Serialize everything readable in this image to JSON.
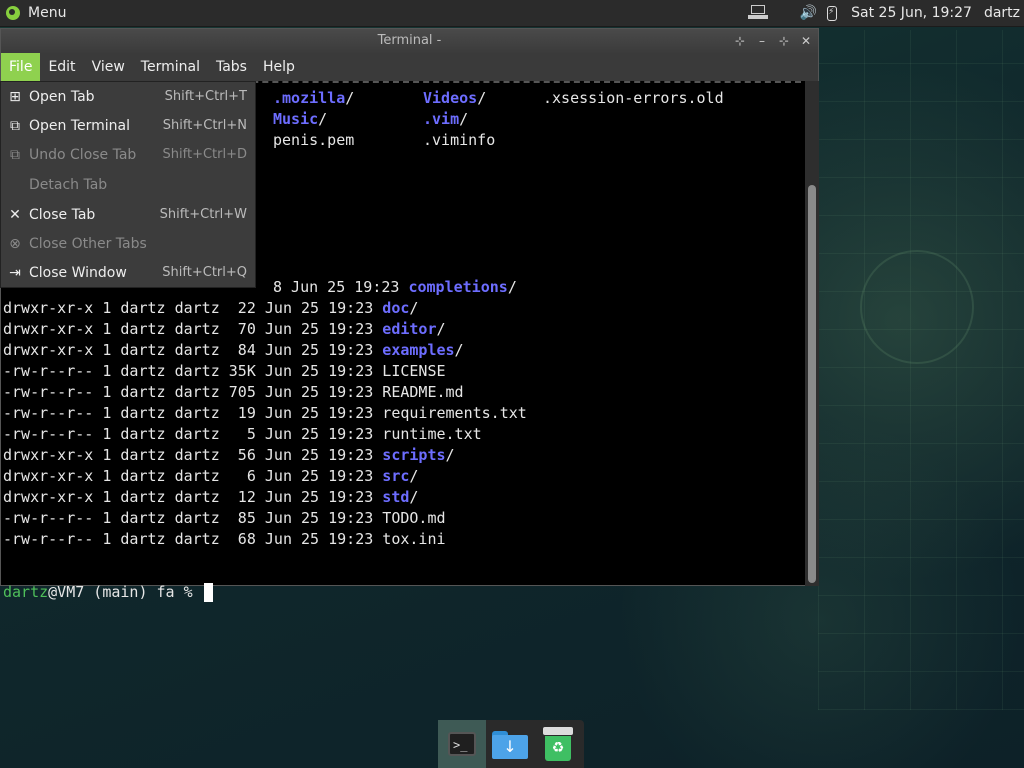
{
  "panel": {
    "menu_label": "Menu",
    "clock": "Sat 25 Jun, 19:27",
    "user": "dartz"
  },
  "window": {
    "title": "Terminal -",
    "menus": [
      "File",
      "Edit",
      "View",
      "Terminal",
      "Tabs",
      "Help"
    ],
    "active_menu": "File"
  },
  "file_menu": {
    "items": [
      {
        "label": "Open Tab",
        "shortcut": "Shift+Ctrl+T",
        "icon": "open-tab-icon",
        "enabled": true
      },
      {
        "label": "Open Terminal",
        "shortcut": "Shift+Ctrl+N",
        "icon": "open-terminal-icon",
        "enabled": true
      },
      {
        "label": "Undo Close Tab",
        "shortcut": "Shift+Ctrl+D",
        "icon": "undo-close-tab-icon",
        "enabled": false
      },
      {
        "label": "Detach Tab",
        "shortcut": "",
        "icon": "",
        "enabled": false
      },
      {
        "label": "Close Tab",
        "shortcut": "Shift+Ctrl+W",
        "icon": "close-icon",
        "enabled": true
      },
      {
        "label": "Close Other Tabs",
        "shortcut": "",
        "icon": "close-other-tabs-icon",
        "enabled": false
      },
      {
        "label": "Close Window",
        "shortcut": "Shift+Ctrl+Q",
        "icon": "close-window-icon",
        "enabled": true
      }
    ]
  },
  "terminal": {
    "top_listing": [
      {
        "col": ".mozilla",
        "suffix": "/",
        "dir": true
      },
      {
        "col": "Videos",
        "suffix": "/",
        "dir": true
      },
      {
        "col": ".xsession-errors.old",
        "suffix": "",
        "dir": false
      },
      {
        "col": "Music",
        "suffix": "/",
        "dir": true
      },
      {
        "col": ".vim",
        "suffix": "/",
        "dir": true
      },
      {
        "col": "penis.pem",
        "suffix": "",
        "dir": false
      },
      {
        "col": ".viminfo",
        "suffix": "",
        "dir": false
      }
    ],
    "partial_row": {
      "prefix": "8 Jun 25 19:23 ",
      "name": "completions",
      "suffix": "/"
    },
    "rows": [
      {
        "perm": "drwxr-xr-x 1 dartz dartz  22 Jun 25 19:23 ",
        "name": "doc",
        "suffix": "/",
        "dir": true
      },
      {
        "perm": "drwxr-xr-x 1 dartz dartz  70 Jun 25 19:23 ",
        "name": "editor",
        "suffix": "/",
        "dir": true
      },
      {
        "perm": "drwxr-xr-x 1 dartz dartz  84 Jun 25 19:23 ",
        "name": "examples",
        "suffix": "/",
        "dir": true
      },
      {
        "perm": "-rw-r--r-- 1 dartz dartz 35K Jun 25 19:23 ",
        "name": "LICENSE",
        "suffix": "",
        "dir": false
      },
      {
        "perm": "-rw-r--r-- 1 dartz dartz 705 Jun 25 19:23 ",
        "name": "README.md",
        "suffix": "",
        "dir": false
      },
      {
        "perm": "-rw-r--r-- 1 dartz dartz  19 Jun 25 19:23 ",
        "name": "requirements.txt",
        "suffix": "",
        "dir": false
      },
      {
        "perm": "-rw-r--r-- 1 dartz dartz   5 Jun 25 19:23 ",
        "name": "runtime.txt",
        "suffix": "",
        "dir": false
      },
      {
        "perm": "drwxr-xr-x 1 dartz dartz  56 Jun 25 19:23 ",
        "name": "scripts",
        "suffix": "/",
        "dir": true
      },
      {
        "perm": "drwxr-xr-x 1 dartz dartz   6 Jun 25 19:23 ",
        "name": "src",
        "suffix": "/",
        "dir": true
      },
      {
        "perm": "drwxr-xr-x 1 dartz dartz  12 Jun 25 19:23 ",
        "name": "std",
        "suffix": "/",
        "dir": true
      },
      {
        "perm": "-rw-r--r-- 1 dartz dartz  85 Jun 25 19:23 ",
        "name": "TODO.md",
        "suffix": "",
        "dir": false
      },
      {
        "perm": "-rw-r--r-- 1 dartz dartz  68 Jun 25 19:23 ",
        "name": "tox.ini",
        "suffix": "",
        "dir": false
      }
    ],
    "prompt_user": "dartz",
    "prompt_rest": "@VM7 (main) fa % "
  },
  "dock": {
    "items": [
      "terminal-icon",
      "downloads-folder-icon",
      "trash-icon"
    ]
  },
  "colors": {
    "accent": "#8fd14f",
    "directory": "#6d6dff",
    "prompt_user": "#4fbf5a"
  }
}
